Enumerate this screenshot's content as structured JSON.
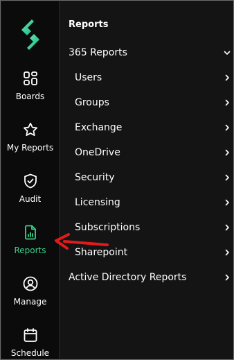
{
  "rail": {
    "items": [
      {
        "label": "Boards",
        "icon": "boards-icon"
      },
      {
        "label": "My Reports",
        "icon": "star-icon"
      },
      {
        "label": "Audit",
        "icon": "shield-check-icon"
      },
      {
        "label": "Reports",
        "icon": "report-chart-icon",
        "active": true
      },
      {
        "label": "Manage",
        "icon": "user-circle-icon"
      },
      {
        "label": "Schedule",
        "icon": "calendar-icon"
      }
    ]
  },
  "panel": {
    "title": "Reports",
    "group": {
      "label": "365 Reports",
      "expanded": true
    },
    "subitems": [
      {
        "label": "Users"
      },
      {
        "label": "Groups"
      },
      {
        "label": "Exchange"
      },
      {
        "label": "OneDrive"
      },
      {
        "label": "Security"
      },
      {
        "label": "Licensing"
      },
      {
        "label": "Subscriptions"
      },
      {
        "label": "Sharepoint"
      }
    ],
    "bottom_item": {
      "label": "Active Directory Reports"
    }
  },
  "colors": {
    "accent": "#3ecf8e",
    "background": "#141414",
    "rail_background": "#0b0b0b",
    "annotation_arrow": "#e01b1b"
  }
}
